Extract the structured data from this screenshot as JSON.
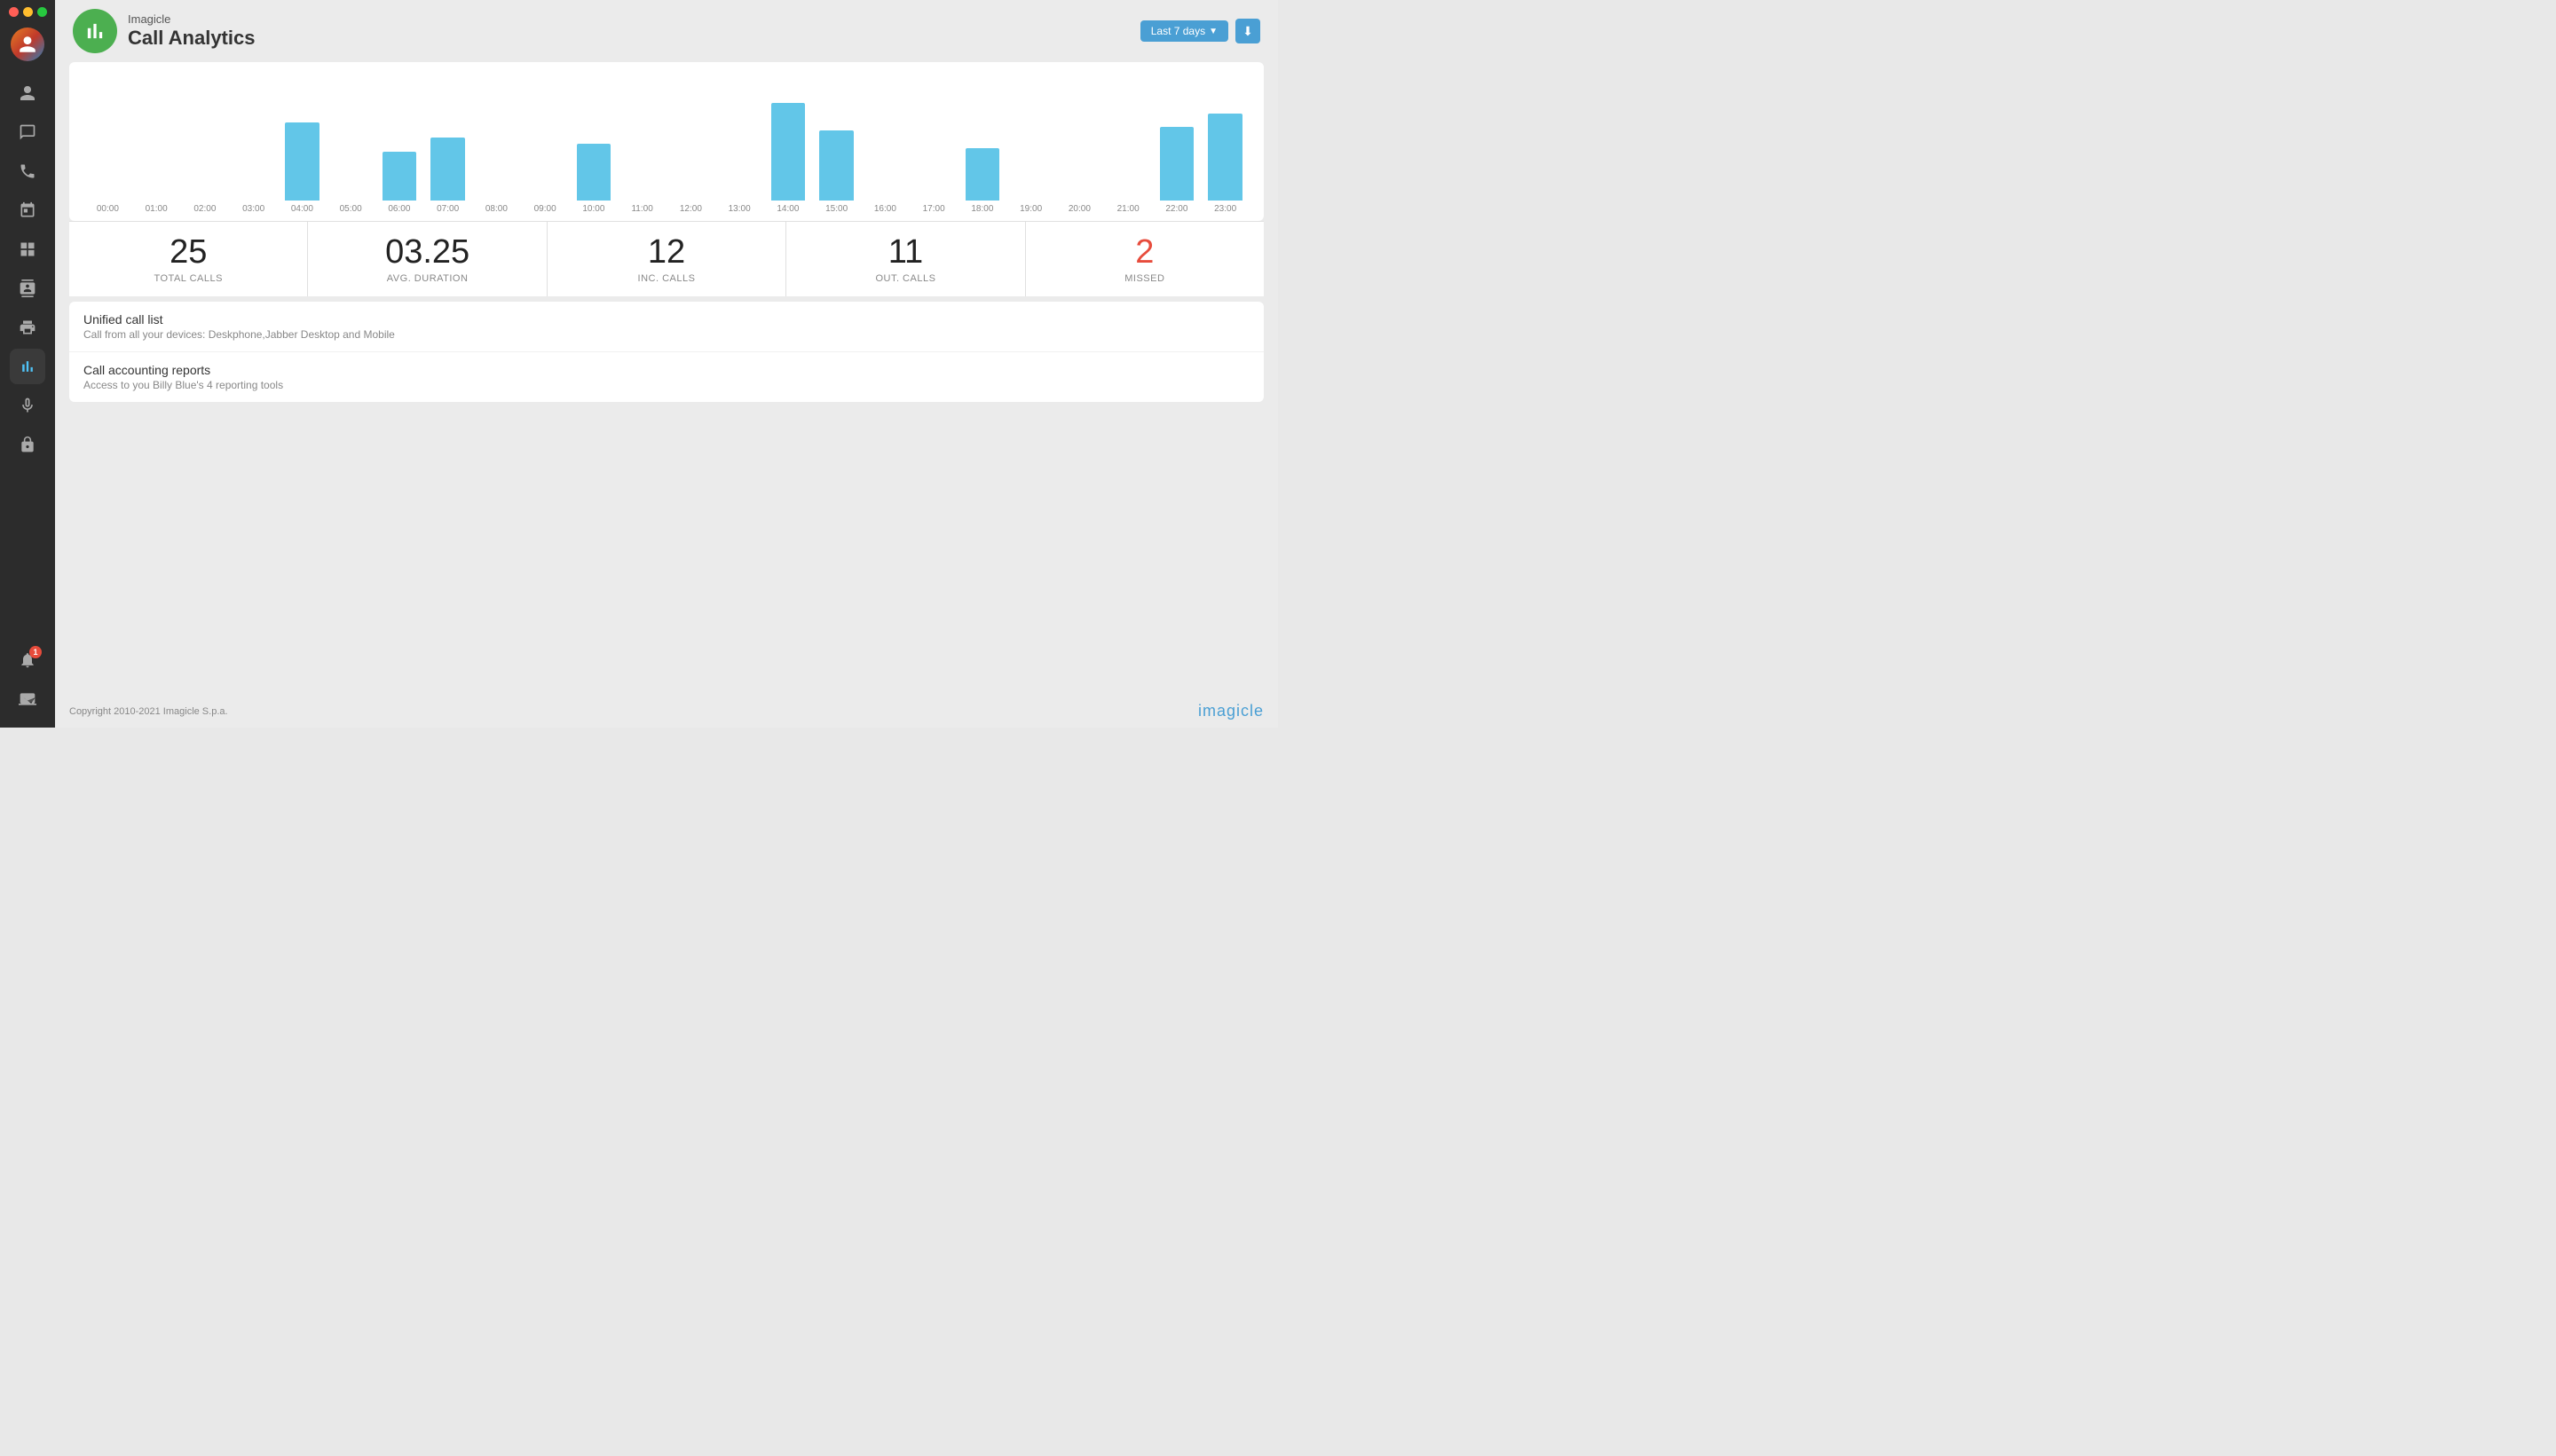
{
  "app": {
    "title_top": "Imagicle",
    "title_main": "Call Analytics"
  },
  "header": {
    "date_filter_label": "Last 7 days"
  },
  "stats": [
    {
      "id": "total-calls",
      "value": "25",
      "label": "TOTAL CALLS",
      "color": "normal"
    },
    {
      "id": "avg-duration",
      "value": "03.25",
      "label": "AVG. DURATION",
      "color": "normal"
    },
    {
      "id": "inc-calls",
      "value": "12",
      "label": "INC. CALLS",
      "color": "normal"
    },
    {
      "id": "out-calls",
      "value": "11",
      "label": "OUT. CALLS",
      "color": "normal"
    },
    {
      "id": "missed",
      "value": "2",
      "label": "MISSED",
      "color": "red"
    }
  ],
  "chart": {
    "hours": [
      "00:00",
      "01:00",
      "02:00",
      "03:00",
      "04:00",
      "05:00",
      "06:00",
      "07:00",
      "08:00",
      "09:00",
      "10:00",
      "11:00",
      "12:00",
      "13:00",
      "14:00",
      "15:00",
      "16:00",
      "17:00",
      "18:00",
      "19:00",
      "20:00",
      "21:00",
      "22:00",
      "23:00"
    ],
    "bars": [
      0,
      0,
      0,
      0,
      72,
      0,
      45,
      58,
      0,
      0,
      52,
      0,
      0,
      0,
      90,
      65,
      0,
      0,
      48,
      0,
      0,
      0,
      68,
      80
    ]
  },
  "links": [
    {
      "id": "unified-call-list",
      "title": "Unified call list",
      "subtitle": "Call from all your devices: Deskphone,Jabber Desktop and Mobile"
    },
    {
      "id": "call-accounting-reports",
      "title": "Call accounting reports",
      "subtitle": "Access to you Billy Blue's 4 reporting tools"
    }
  ],
  "sidebar": {
    "items": [
      {
        "id": "user",
        "icon": "user"
      },
      {
        "id": "chat",
        "icon": "chat"
      },
      {
        "id": "phone",
        "icon": "phone"
      },
      {
        "id": "calendar",
        "icon": "calendar"
      },
      {
        "id": "grid",
        "icon": "grid"
      },
      {
        "id": "contacts",
        "icon": "contacts"
      },
      {
        "id": "print",
        "icon": "print"
      },
      {
        "id": "analytics",
        "icon": "analytics",
        "active": true
      },
      {
        "id": "mic",
        "icon": "mic"
      },
      {
        "id": "lock",
        "icon": "lock"
      }
    ]
  },
  "footer": {
    "copyright": "Copyright 2010-2021 Imagicle S.p.a.",
    "brand": "imagicle"
  }
}
